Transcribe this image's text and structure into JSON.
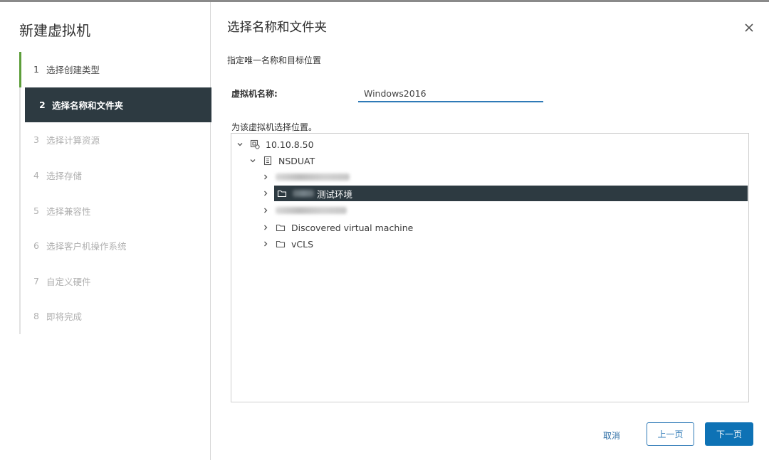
{
  "wizard": {
    "title": "新建虚拟机",
    "steps": [
      {
        "num": "1",
        "label": "选择创建类型"
      },
      {
        "num": "2",
        "label": "选择名称和文件夹"
      },
      {
        "num": "3",
        "label": "选择计算资源"
      },
      {
        "num": "4",
        "label": "选择存储"
      },
      {
        "num": "5",
        "label": "选择兼容性"
      },
      {
        "num": "6",
        "label": "选择客户机操作系统"
      },
      {
        "num": "7",
        "label": "自定义硬件"
      },
      {
        "num": "8",
        "label": "即将完成"
      }
    ]
  },
  "page": {
    "title": "选择名称和文件夹",
    "subtitle": "指定唯一名称和目标位置",
    "name_label": "虚拟机名称:",
    "name_value": "Windows2016",
    "location_label": "为该虚拟机选择位置。"
  },
  "tree": {
    "root": "10.10.8.50",
    "datacenter": "NSDUAT",
    "folders": [
      {
        "label": ""
      },
      {
        "label": "测试环境"
      },
      {
        "label": ""
      },
      {
        "label": "Discovered virtual machine"
      },
      {
        "label": "vCLS"
      }
    ]
  },
  "footer": {
    "cancel": "取消",
    "prev": "上一页",
    "next": "下一页"
  },
  "colors": {
    "active_bg": "#2d3a41",
    "done_bar": "#5d9e3a",
    "primary": "#0e72b5",
    "input_underline": "#2f7ab7"
  }
}
